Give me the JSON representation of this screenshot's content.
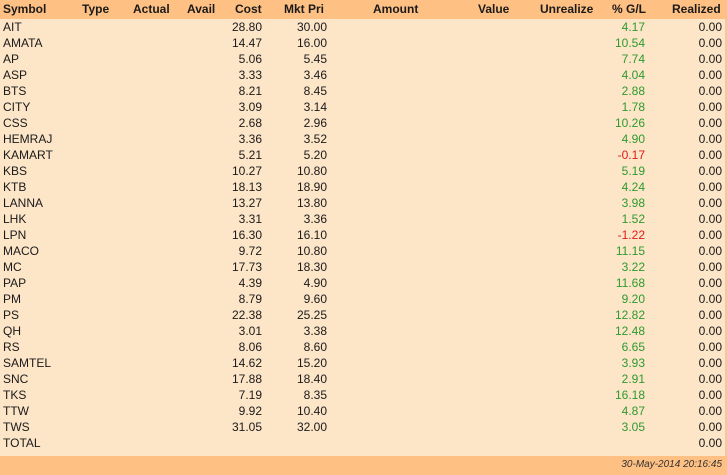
{
  "columns": {
    "symbol": "Symbol",
    "type": "Type",
    "actual": "Actual",
    "avail": "Avail",
    "cost": "Cost",
    "mkt_price": "Mkt Pri",
    "amount": "Amount",
    "value": "Value",
    "unrealize": "Unrealize",
    "pct_gl": "% G/L",
    "realized": "Realized"
  },
  "rows": [
    {
      "symbol": "AIT",
      "cost": "28.80",
      "mkt": "30.00",
      "pct": "4.17",
      "realized": "0.00",
      "sign": "pos"
    },
    {
      "symbol": "AMATA",
      "cost": "14.47",
      "mkt": "16.00",
      "pct": "10.54",
      "realized": "0.00",
      "sign": "pos"
    },
    {
      "symbol": "AP",
      "cost": "5.06",
      "mkt": "5.45",
      "pct": "7.74",
      "realized": "0.00",
      "sign": "pos"
    },
    {
      "symbol": "ASP",
      "cost": "3.33",
      "mkt": "3.46",
      "pct": "4.04",
      "realized": "0.00",
      "sign": "pos"
    },
    {
      "symbol": "BTS",
      "cost": "8.21",
      "mkt": "8.45",
      "pct": "2.88",
      "realized": "0.00",
      "sign": "pos"
    },
    {
      "symbol": "CITY",
      "cost": "3.09",
      "mkt": "3.14",
      "pct": "1.78",
      "realized": "0.00",
      "sign": "pos"
    },
    {
      "symbol": "CSS",
      "cost": "2.68",
      "mkt": "2.96",
      "pct": "10.26",
      "realized": "0.00",
      "sign": "pos"
    },
    {
      "symbol": "HEMRAJ",
      "cost": "3.36",
      "mkt": "3.52",
      "pct": "4.90",
      "realized": "0.00",
      "sign": "pos"
    },
    {
      "symbol": "KAMART",
      "cost": "5.21",
      "mkt": "5.20",
      "pct": "-0.17",
      "realized": "0.00",
      "sign": "neg"
    },
    {
      "symbol": "KBS",
      "cost": "10.27",
      "mkt": "10.80",
      "pct": "5.19",
      "realized": "0.00",
      "sign": "pos"
    },
    {
      "symbol": "KTB",
      "cost": "18.13",
      "mkt": "18.90",
      "pct": "4.24",
      "realized": "0.00",
      "sign": "pos"
    },
    {
      "symbol": "LANNA",
      "cost": "13.27",
      "mkt": "13.80",
      "pct": "3.98",
      "realized": "0.00",
      "sign": "pos"
    },
    {
      "symbol": "LHK",
      "cost": "3.31",
      "mkt": "3.36",
      "pct": "1.52",
      "realized": "0.00",
      "sign": "pos"
    },
    {
      "symbol": "LPN",
      "cost": "16.30",
      "mkt": "16.10",
      "pct": "-1.22",
      "realized": "0.00",
      "sign": "neg"
    },
    {
      "symbol": "MACO",
      "cost": "9.72",
      "mkt": "10.80",
      "pct": "11.15",
      "realized": "0.00",
      "sign": "pos"
    },
    {
      "symbol": "MC",
      "cost": "17.73",
      "mkt": "18.30",
      "pct": "3.22",
      "realized": "0.00",
      "sign": "pos"
    },
    {
      "symbol": "PAP",
      "cost": "4.39",
      "mkt": "4.90",
      "pct": "11.68",
      "realized": "0.00",
      "sign": "pos"
    },
    {
      "symbol": "PM",
      "cost": "8.79",
      "mkt": "9.60",
      "pct": "9.20",
      "realized": "0.00",
      "sign": "pos"
    },
    {
      "symbol": "PS",
      "cost": "22.38",
      "mkt": "25.25",
      "pct": "12.82",
      "realized": "0.00",
      "sign": "pos"
    },
    {
      "symbol": "QH",
      "cost": "3.01",
      "mkt": "3.38",
      "pct": "12.48",
      "realized": "0.00",
      "sign": "pos"
    },
    {
      "symbol": "RS",
      "cost": "8.06",
      "mkt": "8.60",
      "pct": "6.65",
      "realized": "0.00",
      "sign": "pos"
    },
    {
      "symbol": "SAMTEL",
      "cost": "14.62",
      "mkt": "15.20",
      "pct": "3.93",
      "realized": "0.00",
      "sign": "pos"
    },
    {
      "symbol": "SNC",
      "cost": "17.88",
      "mkt": "18.40",
      "pct": "2.91",
      "realized": "0.00",
      "sign": "pos"
    },
    {
      "symbol": "TKS",
      "cost": "7.19",
      "mkt": "8.35",
      "pct": "16.18",
      "realized": "0.00",
      "sign": "pos"
    },
    {
      "symbol": "TTW",
      "cost": "9.92",
      "mkt": "10.40",
      "pct": "4.87",
      "realized": "0.00",
      "sign": "pos"
    },
    {
      "symbol": "TWS",
      "cost": "31.05",
      "mkt": "32.00",
      "pct": "3.05",
      "realized": "0.00",
      "sign": "pos"
    }
  ],
  "total": {
    "label": "TOTAL",
    "realized": "0.00"
  },
  "footer": {
    "timestamp": "30-May-2014 20:16:45"
  },
  "colors": {
    "header_bg": "#ffc083",
    "body_bg": "#fde5c8",
    "gain": "#2e9a2e",
    "loss": "#e01a1a"
  }
}
